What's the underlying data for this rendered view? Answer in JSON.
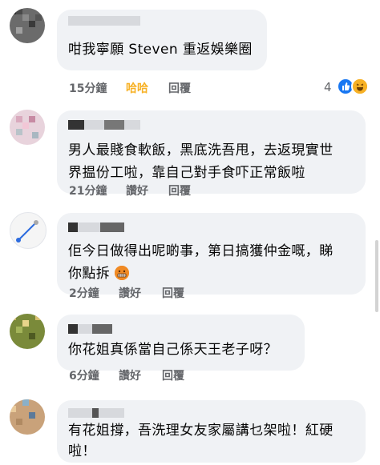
{
  "comments": [
    {
      "text_lines": [
        "咁我寧願 Steven 重返娛樂圈"
      ],
      "time": "15分鐘",
      "like_label": "哈哈",
      "reply_label": "回覆",
      "reactions": {
        "count": "4",
        "icons": [
          "like-icon",
          "haha-icon"
        ]
      }
    },
    {
      "text_lines": [
        "男人最賤食軟飯，黑底洗吾甩，去返現實世",
        "界揾份工啦，靠自己對手食吓正常飯啦"
      ],
      "time": "21分鐘",
      "like_label": "讚好",
      "reply_label": "回覆"
    },
    {
      "text_lines": [
        "佢今日做得出呢啲事，第日搞獲仲金嘅，睇",
        "你點拆"
      ],
      "emoji": "grimacing-face-icon",
      "time": "2分鐘",
      "like_label": "讚好",
      "reply_label": "回覆"
    },
    {
      "text_lines": [
        "你花姐真係當自己係天王老子呀？"
      ],
      "time": "6分鐘",
      "like_label": "讚好",
      "reply_label": "回覆"
    },
    {
      "text_lines": [
        "有花姐撐，吾洗理女友家屬講乜架啦！紅硬",
        "啦！"
      ]
    }
  ],
  "colors": {
    "bubble": "#f0f2f5",
    "meta_text": "#65676b",
    "reacted": "#f7b125",
    "like_blue": "#1877f2"
  }
}
